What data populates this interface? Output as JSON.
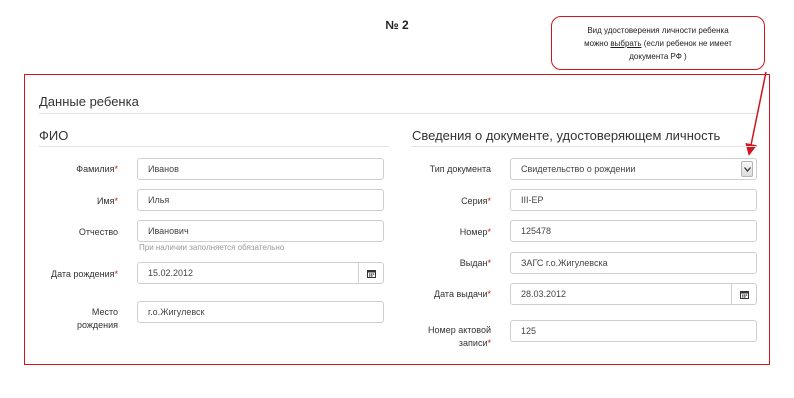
{
  "page_number": "№ 2",
  "callout": {
    "line1": "Вид удостоверения личности ребенка",
    "line2_prefix": "можно ",
    "line2_link": "выбрать",
    "line2_suffix": " (если ребенок не имеет",
    "line3": "документа РФ )"
  },
  "section_title": "Данные ребенка",
  "left": {
    "title": "ФИО",
    "surname": {
      "label": "Фамилия",
      "required": "*",
      "value": "Иванов"
    },
    "name": {
      "label": "Имя",
      "required": "*",
      "value": "Илья"
    },
    "patronymic": {
      "label": "Отчество",
      "value": "Иванович",
      "hint": "При наличии заполняется обязательно"
    },
    "birth_date": {
      "label": "Дата рождения",
      "required": "*",
      "value": "15.02.2012"
    },
    "birth_place": {
      "label_line1": "Место",
      "label_line2": "рождения",
      "value": "г.о.Жигулевск"
    }
  },
  "right": {
    "title": "Сведения о документе, удостоверяющем личность",
    "doc_type": {
      "label": "Тип документа",
      "value": "Свидетельство о рождении"
    },
    "series": {
      "label": "Серия",
      "required": "*",
      "value": "III-ЕР"
    },
    "number": {
      "label": "Номер",
      "required": "*",
      "value": "125478"
    },
    "issued_by": {
      "label": "Выдан",
      "required": "*",
      "value": "ЗАГС г.о.Жигулевска"
    },
    "issue_date": {
      "label": "Дата выдачи",
      "required": "*",
      "value": "28.03.2012"
    },
    "record_number": {
      "label_line1": "Номер актовой",
      "label_line2": "записи",
      "required": "*",
      "value": "125"
    }
  },
  "colors": {
    "highlight_red": "#d0161e",
    "border_gray": "#cfcfcf"
  }
}
